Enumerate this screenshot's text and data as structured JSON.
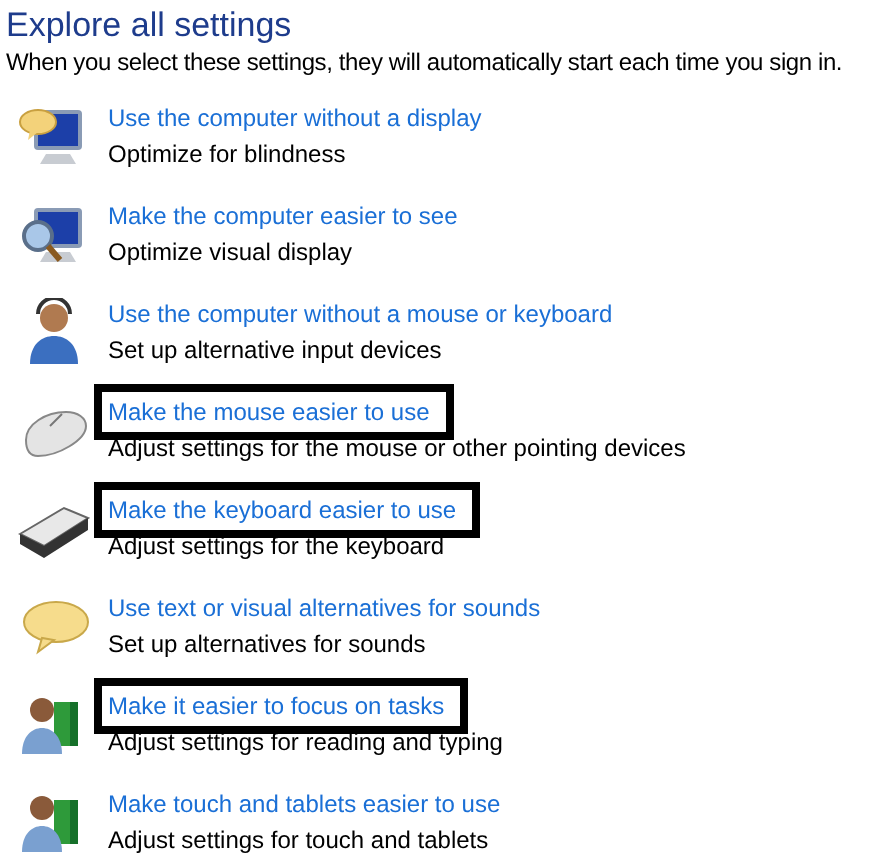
{
  "title": "Explore all settings",
  "subtitle": "When you select these settings, they will automatically start each time you sign in.",
  "settings": [
    {
      "link": "Use the computer without a display",
      "description": "Optimize for blindness",
      "highlighted": false
    },
    {
      "link": "Make the computer easier to see",
      "description": "Optimize visual display",
      "highlighted": false
    },
    {
      "link": "Use the computer without a mouse or keyboard",
      "description": "Set up alternative input devices",
      "highlighted": false
    },
    {
      "link": "Make the mouse easier to use",
      "description": "Adjust settings for the mouse or other pointing devices",
      "highlighted": true
    },
    {
      "link": "Make the keyboard easier to use",
      "description": "Adjust settings for the keyboard",
      "highlighted": true
    },
    {
      "link": "Use text or visual alternatives for sounds",
      "description": "Set up alternatives for sounds",
      "highlighted": false
    },
    {
      "link": "Make it easier to focus on tasks",
      "description": "Adjust settings for reading and typing",
      "highlighted": true
    },
    {
      "link": "Make touch and tablets easier to use",
      "description": "Adjust settings for touch and tablets",
      "highlighted": false
    }
  ]
}
